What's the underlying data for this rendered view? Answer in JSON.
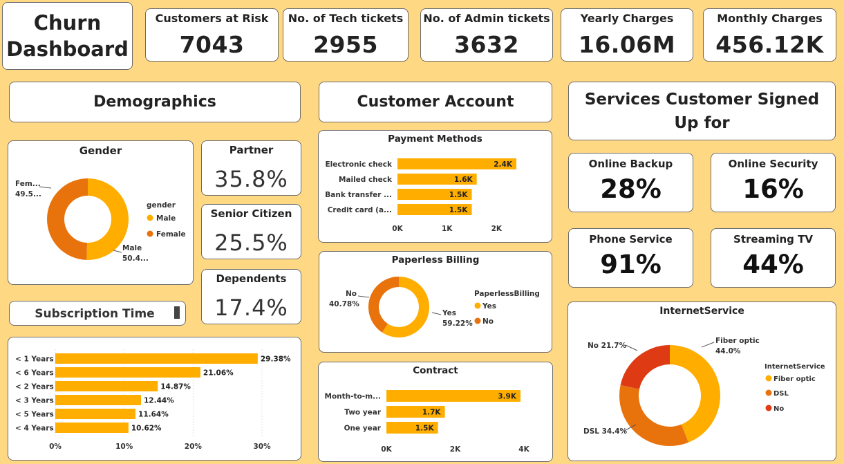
{
  "header": {
    "title_line1": "Churn",
    "title_line2": "Dashboard"
  },
  "kpis": [
    {
      "label": "Customers at Risk",
      "value": "7043"
    },
    {
      "label": "No. of Tech tickets",
      "value": "2955"
    },
    {
      "label": "No. of Admin tickets",
      "value": "3632"
    },
    {
      "label": "Yearly Charges",
      "value": "16.06M"
    },
    {
      "label": "Monthly Charges",
      "value": "456.12K"
    }
  ],
  "sections": {
    "demographics": "Demographics",
    "customer_account": "Customer Account",
    "services": "Services Customer Signed Up for"
  },
  "demographics": {
    "partner": {
      "label": "Partner",
      "value": "35.8%"
    },
    "senior": {
      "label": "Senior Citizen",
      "value": "25.5%"
    },
    "dependents": {
      "label": "Dependents",
      "value": "17.4%"
    },
    "subscription_title": "Subscription Time"
  },
  "services": [
    {
      "label": "Online Backup",
      "value": "28%"
    },
    {
      "label": "Online Security",
      "value": "16%"
    },
    {
      "label": "Phone Service",
      "value": "91%"
    },
    {
      "label": "Streaming TV",
      "value": "44%"
    }
  ],
  "colors": {
    "accent": "#FFAE00",
    "dark_orange": "#E8730C",
    "red": "#DE3A14",
    "background": "#FFD884"
  },
  "chart_data": [
    {
      "id": "gender",
      "type": "pie",
      "title": "Gender",
      "legend_title": "gender",
      "slices": [
        {
          "name": "Male",
          "value": 50.4,
          "label": "Male",
          "label2": "50.4...",
          "color": "#FFAE00"
        },
        {
          "name": "Female",
          "value": 49.5,
          "label": "Fem...",
          "label2": "49.5...",
          "color": "#E8730C"
        }
      ]
    },
    {
      "id": "subscription",
      "type": "bar",
      "title": "Subscription Time",
      "categories": [
        "< 1 Years",
        "< 6 Years",
        "< 2 Years",
        "< 3 Years",
        "< 5 Years",
        "< 4 Years"
      ],
      "values": [
        29.38,
        21.06,
        14.87,
        12.44,
        11.64,
        10.62
      ],
      "value_labels": [
        "29.38%",
        "21.06%",
        "14.87%",
        "12.44%",
        "11.64%",
        "10.62%"
      ],
      "xticks": [
        {
          "v": 0,
          "t": "0%"
        },
        {
          "v": 10,
          "t": "10%"
        },
        {
          "v": 20,
          "t": "20%"
        },
        {
          "v": 30,
          "t": "30%"
        }
      ],
      "xlim": [
        0,
        31
      ]
    },
    {
      "id": "payment",
      "type": "bar",
      "title": "Payment Methods",
      "categories": [
        "Electronic check",
        "Mailed check",
        "Bank transfer ...",
        "Credit card (a..."
      ],
      "values": [
        2.4,
        1.6,
        1.5,
        1.5
      ],
      "value_labels": [
        "2.4K",
        "1.6K",
        "1.5K",
        "1.5K"
      ],
      "xticks": [
        {
          "v": 0,
          "t": "0K"
        },
        {
          "v": 1,
          "t": "1K"
        },
        {
          "v": 2,
          "t": "2K"
        }
      ],
      "xlim": [
        0,
        3.0
      ]
    },
    {
      "id": "paperless",
      "type": "pie",
      "title": "Paperless Billing",
      "legend_title": "PaperlessBilling",
      "slices": [
        {
          "name": "Yes",
          "value": 59.22,
          "label": "Yes",
          "label2": "59.22%",
          "color": "#FFAE00"
        },
        {
          "name": "No",
          "value": 40.78,
          "label": "No",
          "label2": "40.78%",
          "color": "#E8730C"
        }
      ]
    },
    {
      "id": "contract",
      "type": "bar",
      "title": "Contract",
      "categories": [
        "Month-to-m...",
        "Two year",
        "One year"
      ],
      "values": [
        3.9,
        1.7,
        1.5
      ],
      "value_labels": [
        "3.9K",
        "1.7K",
        "1.5K"
      ],
      "xticks": [
        {
          "v": 0,
          "t": "0K"
        },
        {
          "v": 2,
          "t": "2K"
        },
        {
          "v": 4,
          "t": "4K"
        }
      ],
      "xlim": [
        0,
        4.0
      ]
    },
    {
      "id": "internet",
      "type": "pie",
      "title": "InternetService",
      "legend_title": "InternetService",
      "slices": [
        {
          "name": "Fiber optic",
          "value": 44.0,
          "label": "Fiber optic",
          "label2": "44.0%",
          "color": "#FFAE00"
        },
        {
          "name": "DSL",
          "value": 34.4,
          "label": "DSL 34.4%",
          "label2": "",
          "color": "#E8730C"
        },
        {
          "name": "No",
          "value": 21.7,
          "label": "No 21.7%",
          "label2": "",
          "color": "#DE3A14"
        }
      ]
    }
  ]
}
